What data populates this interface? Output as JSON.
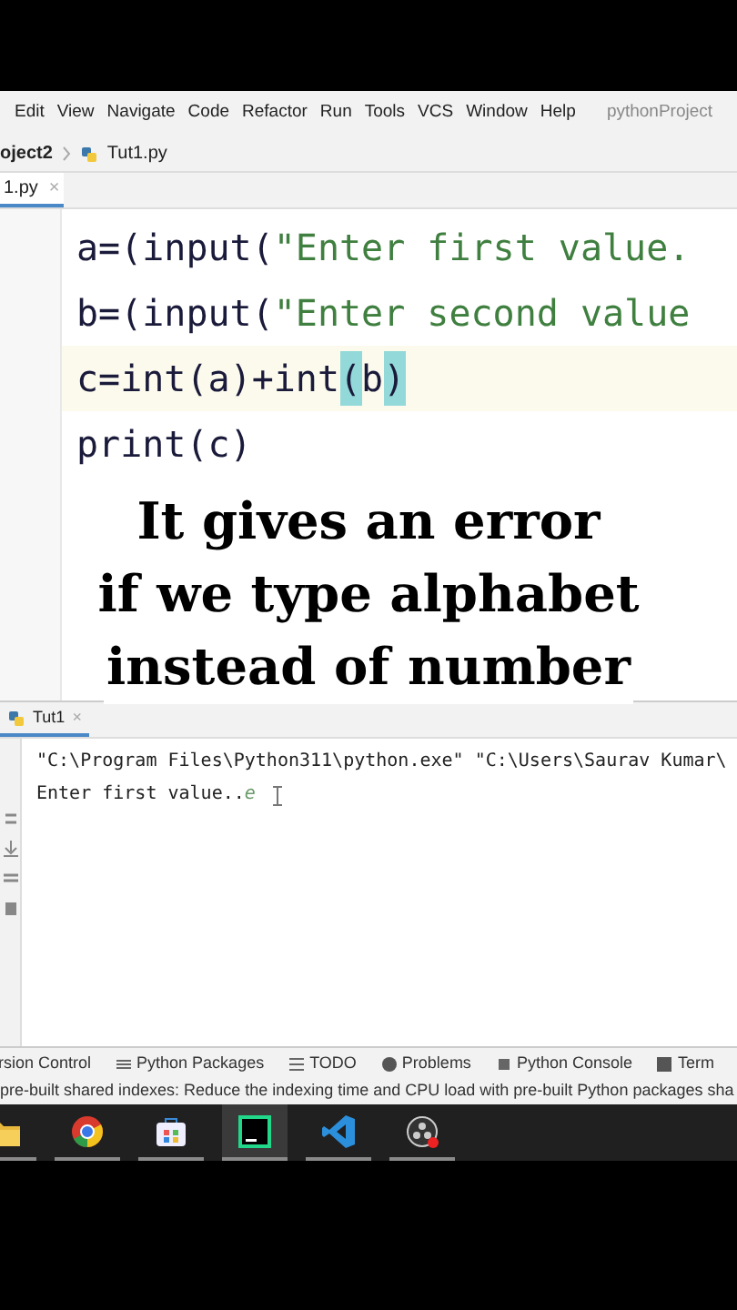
{
  "menu_bar": {
    "items": [
      "Edit",
      "View",
      "Navigate",
      "Code",
      "Refactor",
      "Run",
      "Tools",
      "VCS",
      "Window",
      "Help"
    ],
    "project_title": "pythonProject"
  },
  "breadcrumb": {
    "project": "oject2",
    "file": "Tut1.py"
  },
  "editor_tab": {
    "label": "1.py",
    "close": "×"
  },
  "code_lines": [
    {
      "current": false,
      "segments": [
        {
          "kind": "code",
          "text": "a=(input("
        },
        {
          "kind": "string",
          "text": "\"Enter first value."
        }
      ]
    },
    {
      "current": false,
      "segments": [
        {
          "kind": "code",
          "text": "b=(input("
        },
        {
          "kind": "string",
          "text": "\"Enter second value"
        }
      ]
    },
    {
      "current": true,
      "segments": [
        {
          "kind": "code",
          "text": "c=int(a)+int"
        },
        {
          "kind": "matched",
          "text": "("
        },
        {
          "kind": "code",
          "text": "b"
        },
        {
          "kind": "matched",
          "text": ")"
        }
      ]
    },
    {
      "current": false,
      "segments": [
        {
          "kind": "code",
          "text": "print(c)"
        }
      ]
    }
  ],
  "caption": [
    "It gives an error",
    "if we type alphabet",
    "instead of number"
  ],
  "run_panel": {
    "tab": "Tut1",
    "close": "×",
    "command": "\"C:\\Program Files\\Python311\\python.exe\" \"C:\\Users\\Saurav Kumar\\",
    "prompt": "Enter first value..",
    "typed": "e"
  },
  "tool_windows": [
    "rsion Control",
    "Python Packages",
    "TODO",
    "Problems",
    "Python Console",
    "Term"
  ],
  "status_message": "pre-built shared indexes: Reduce the indexing time and CPU load with pre-built Python packages sha",
  "taskbar": [
    {
      "kind": "folder",
      "selected": false
    },
    {
      "kind": "browser",
      "selected": false
    },
    {
      "kind": "store",
      "selected": false
    },
    {
      "kind": "ide",
      "selected": true
    },
    {
      "kind": "editor",
      "selected": false
    },
    {
      "kind": "recorder",
      "selected": false
    }
  ]
}
